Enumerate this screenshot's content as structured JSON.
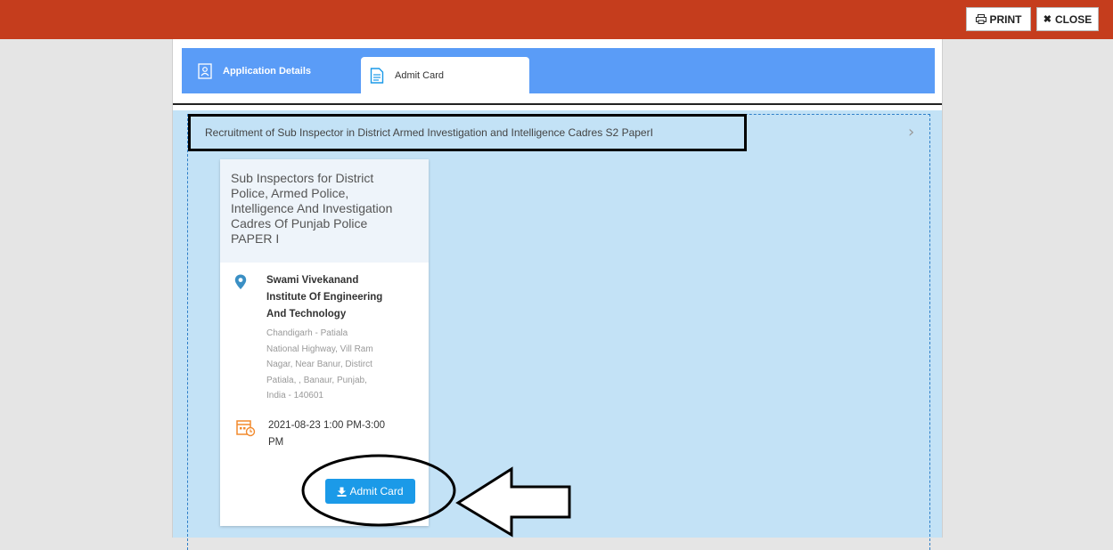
{
  "toolbar": {
    "print_label": "PRINT",
    "close_label": "CLOSE"
  },
  "tabs": {
    "application_details": "Application Details",
    "admit_card": "Admit Card"
  },
  "exam": {
    "title": "Recruitment of Sub Inspector in District Armed Investigation and Intelligence Cadres S2 PaperI",
    "card": {
      "heading_lines": [
        "Sub Inspectors for District",
        "Police, Armed Police,",
        "Intelligence And Investigation",
        "Cadres Of Punjab Police",
        "PAPER I"
      ],
      "venue_name_lines": [
        "Swami Vivekanand",
        "Institute Of Engineering",
        "And Technology"
      ],
      "venue_address_lines": [
        "Chandigarh - Patiala",
        "National Highway, Vill Ram",
        "Nagar, Near Banur, Distirct",
        "Patiala, , Banaur, Punjab,",
        "India - 140601"
      ],
      "datetime_lines": [
        "2021-08-23 1:00 PM-3:00",
        "PM"
      ],
      "button_label": "Admit Card"
    }
  },
  "colors": {
    "topbar": "#c53d1d",
    "tabbar": "#5a9cf7",
    "content": "#c3e2f6",
    "button": "#1b9ae8",
    "calendar_icon": "#f28a2d",
    "pin_icon": "#3a8fc4"
  }
}
